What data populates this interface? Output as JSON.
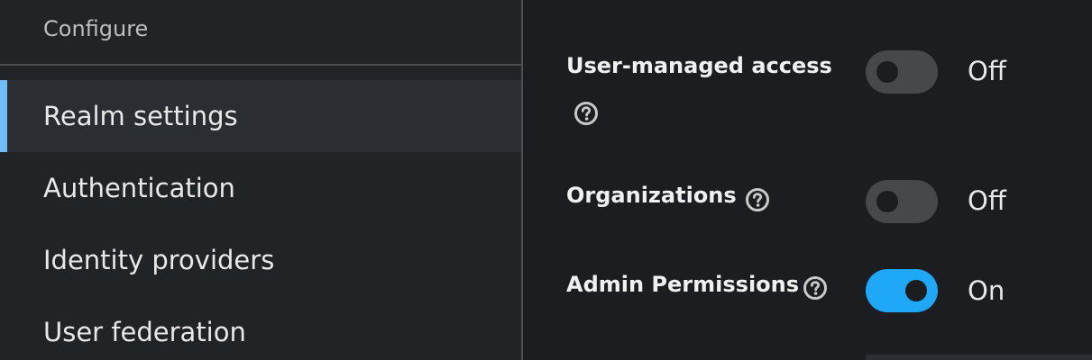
{
  "sidebar": {
    "group_title": "Configure",
    "items": [
      {
        "label": "Realm settings",
        "active": true
      },
      {
        "label": "Authentication",
        "active": false
      },
      {
        "label": "Identity providers",
        "active": false
      },
      {
        "label": "User federation",
        "active": false
      }
    ]
  },
  "settings": [
    {
      "label": "User-managed access",
      "state_label": "Off",
      "enabled": false
    },
    {
      "label": "Organizations",
      "state_label": "Off",
      "enabled": false
    },
    {
      "label": "Admin Permissions",
      "state_label": "On",
      "enabled": true
    }
  ],
  "colors": {
    "active_indicator": "#73bcf7",
    "toggle_on": "#1fa7f8",
    "toggle_off": "#46484c"
  }
}
